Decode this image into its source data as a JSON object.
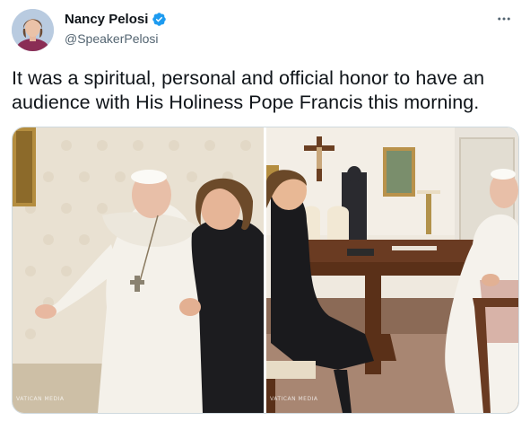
{
  "author": {
    "display_name": "Nancy Pelosi",
    "handle": "@SpeakerPelosi",
    "verified": true,
    "avatar_icon": "profile-photo"
  },
  "tweet": {
    "text": "It was a spiritual, personal and official honor to have an audience with His Holiness Pope Francis this morning."
  },
  "media": {
    "photos": [
      {
        "watermark": "VATICAN MEDIA"
      },
      {
        "watermark": "VATICAN MEDIA"
      }
    ]
  },
  "icons": {
    "more": "more-horizontal-icon",
    "verified": "verified-badge-icon"
  },
  "colors": {
    "verified_blue": "#1d9bf0",
    "text_primary": "#0f1419",
    "text_secondary": "#536471",
    "border": "#cfd9de"
  }
}
